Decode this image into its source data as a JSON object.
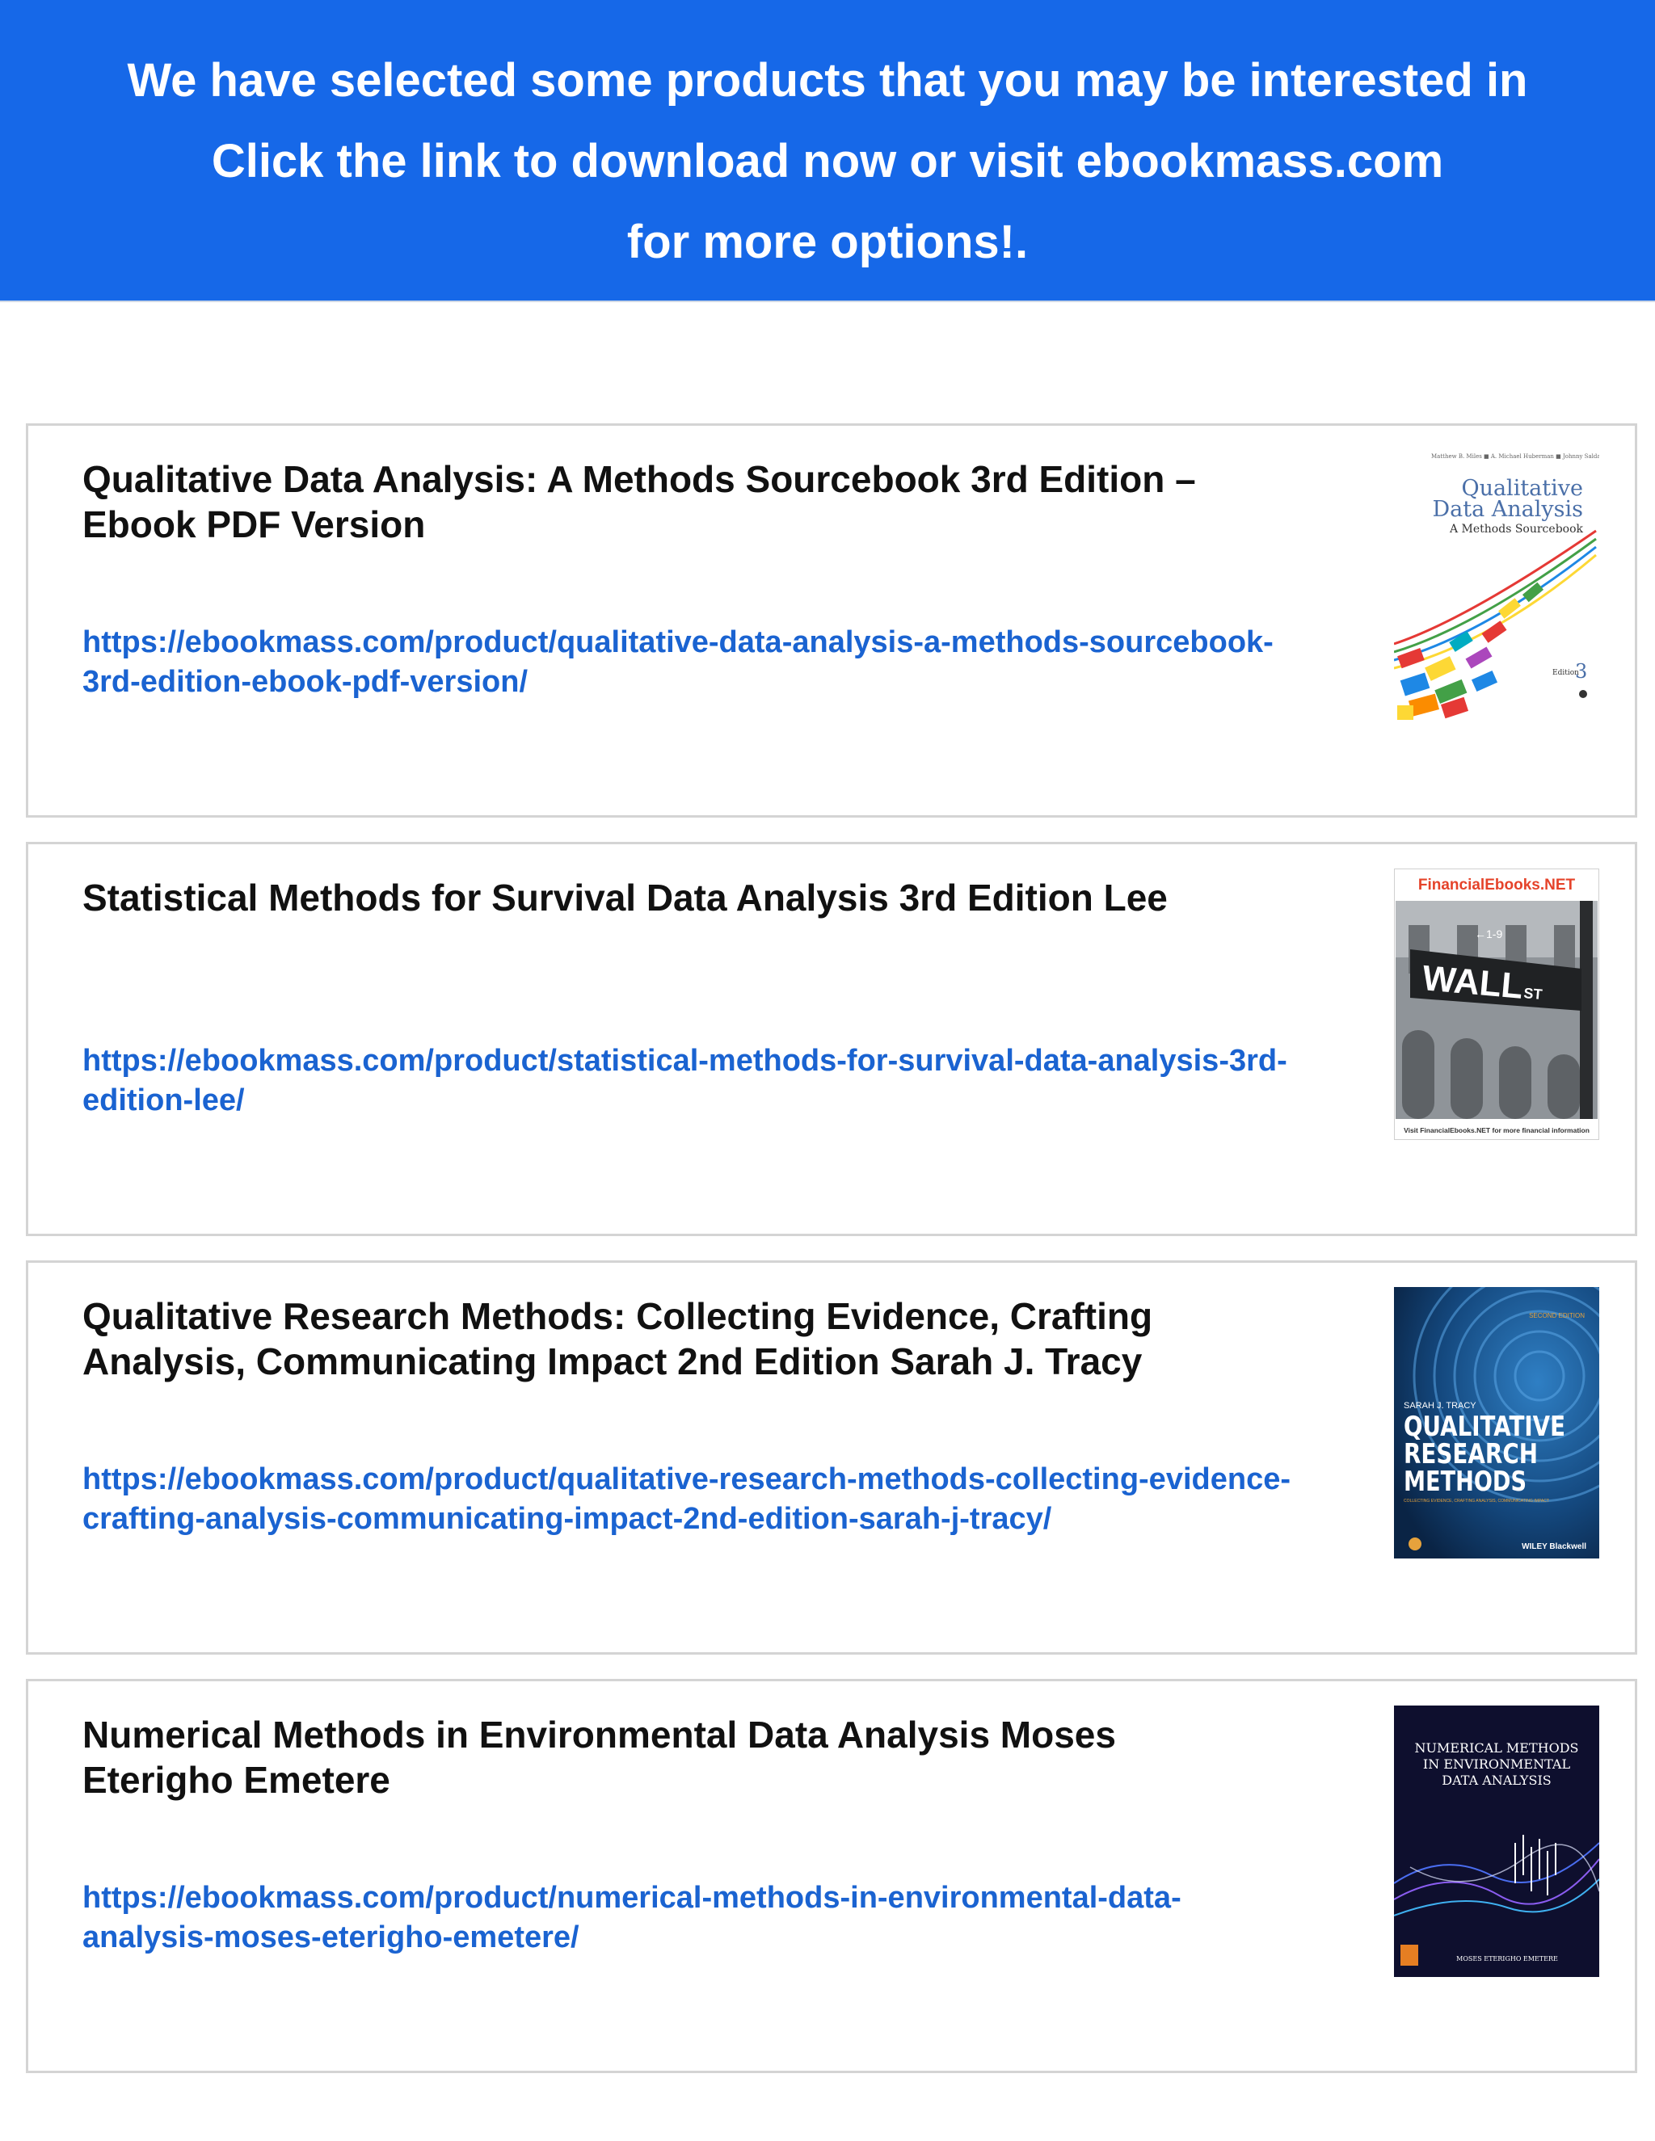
{
  "banner": {
    "line1": "We have selected some products that you may be interested in",
    "line2": "Click the link to download now or visit ebookmass.com",
    "line3": "for more options!."
  },
  "products": [
    {
      "title": "Qualitative Data Analysis: A Methods Sourcebook 3rd Edition – Ebook PDF Version",
      "url": "https://ebookmass.com/product/qualitative-data-analysis-a-methods-sourcebook-3rd-edition-ebook-pdf-version/",
      "cover": {
        "authors": "Matthew B. Miles ■ A. Michael Huberman ■ Johnny Saldaña",
        "title_line1": "Qualitative",
        "title_line2": "Data Analysis",
        "subtitle": "A Methods Sourcebook",
        "edition_label": "Edition",
        "edition_number": "3",
        "icon": "publisher-logo-icon"
      }
    },
    {
      "title": "Statistical Methods for Survival Data Analysis 3rd Edition Lee",
      "url": "https://ebookmass.com/product/statistical-methods-for-survival-data-analysis-3rd-edition-lee/",
      "cover": {
        "header": "FinancialEbooks.NET",
        "sign_main": "WALL",
        "sign_st": "ST",
        "sign_number": "←1-9",
        "footer": "Visit FinancialEbooks.NET for more financial information"
      }
    },
    {
      "title": "Qualitative Research Methods: Collecting Evidence, Crafting Analysis, Communicating Impact 2nd Edition Sarah J. Tracy",
      "url": "https://ebookmass.com/product/qualitative-research-methods-collecting-evidence-crafting-analysis-communicating-impact-2nd-edition-sarah-j-tracy/",
      "cover": {
        "edition": "SECOND EDITION",
        "author": "SARAH J. TRACY",
        "title_line1": "QUALITATIVE",
        "title_line2": "RESEARCH",
        "title_line3": "METHODS",
        "subtitle": "COLLECTING EVIDENCE, CRAFTING ANALYSIS, COMMUNICATING IMPACT",
        "publisher": "WILEY Blackwell"
      }
    },
    {
      "title": "Numerical Methods in Environmental Data Analysis Moses Eterigho Emetere",
      "url": "https://ebookmass.com/product/numerical-methods-in-environmental-data-analysis-moses-eterigho-emetere/",
      "cover": {
        "title_line1": "NUMERICAL METHODS",
        "title_line2": "IN ENVIRONMENTAL",
        "title_line3": "DATA ANALYSIS",
        "author": "MOSES ETERIGHO EMETERE"
      }
    }
  ],
  "colors": {
    "banner_bg": "#1668e8",
    "link": "#1a63d1",
    "card_border": "#d4d4d4"
  }
}
